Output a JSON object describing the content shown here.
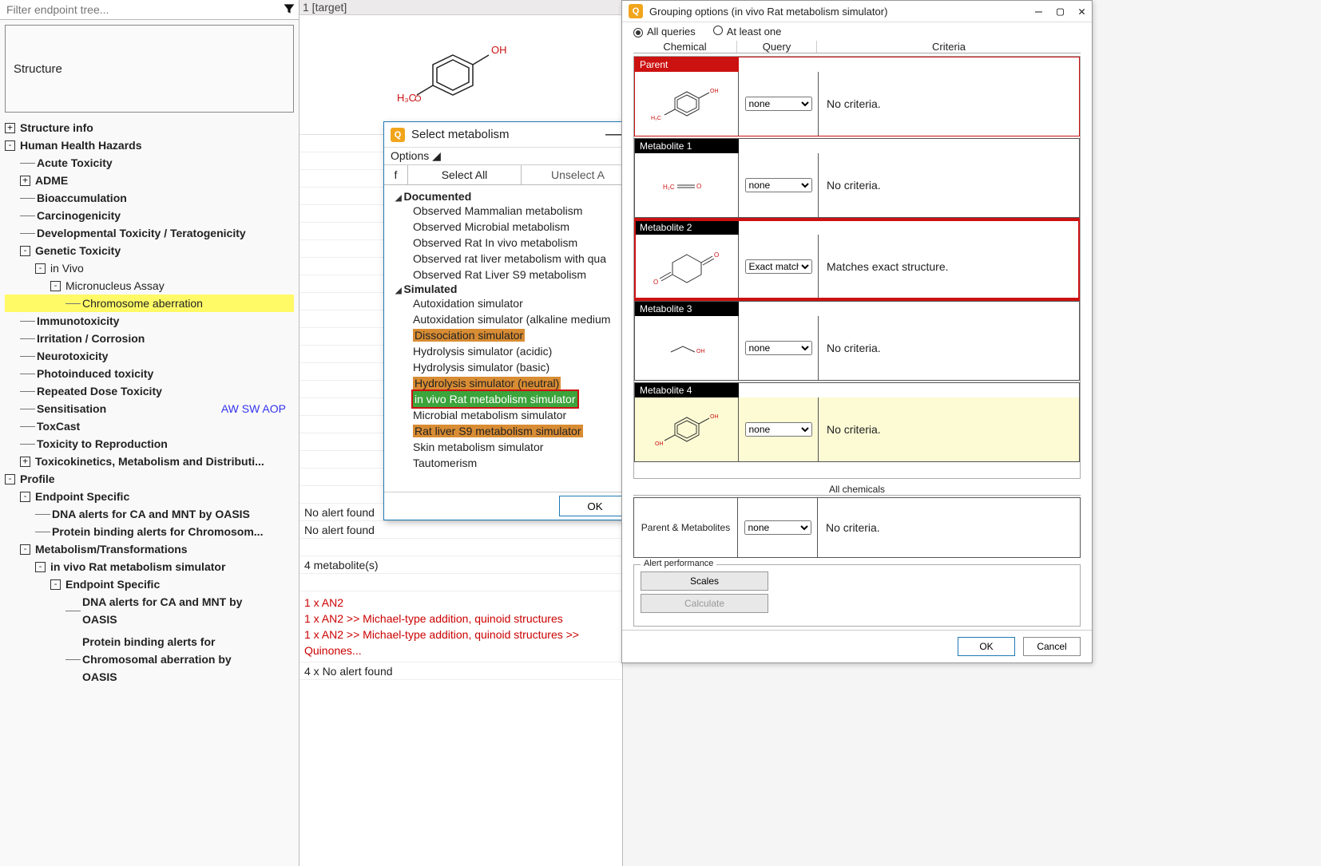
{
  "filter": {
    "placeholder": "Filter endpoint tree..."
  },
  "structure_label": "Structure",
  "tree": {
    "structure_info": "Structure info",
    "hhh": "Human Health Hazards",
    "acute": "Acute Toxicity",
    "adme": "ADME",
    "bioacc": "Bioaccumulation",
    "carcino": "Carcinogenicity",
    "devtox": "Developmental Toxicity / Teratogenicity",
    "gentox": "Genetic Toxicity",
    "invivo": "in Vivo",
    "micro": "Micronucleus Assay",
    "chrom": "Chromosome aberration",
    "immuno": "Immunotoxicity",
    "irrit": "Irritation / Corrosion",
    "neuro": "Neurotoxicity",
    "photo": "Photoinduced toxicity",
    "repdose": "Repeated Dose Toxicity",
    "sens": "Sensitisation",
    "sens_extra": "AW SW AOP",
    "toxcast": "ToxCast",
    "repro": "Toxicity to Reproduction",
    "toxkin": "Toxicokinetics, Metabolism and Distributi...",
    "profile": "Profile",
    "ep_spec": "Endpoint Specific",
    "dna_ca": "DNA alerts for CA and MNT by OASIS",
    "prot_bind": "Protein binding alerts for Chromosom...",
    "metab": "Metabolism/Transformations",
    "invivorat": "in vivo Rat metabolism simulator",
    "ep_spec2": "Endpoint Specific",
    "dna_ca2_a": "DNA alerts for CA and MNT by",
    "dna_ca2_b": "OASIS",
    "prot_bind2_a": "Protein binding alerts for",
    "prot_bind2_b": "Chromosomal aberration by",
    "prot_bind2_c": "OASIS"
  },
  "target_header": "1 [target]",
  "mid": {
    "no_alert": "No alert found",
    "four_metab": "4 metabolite(s)",
    "an2_1": "1 x AN2",
    "an2_2": "1 x AN2 >>  Michael-type addition, quinoid structures",
    "an2_3": "1 x AN2 >>  Michael-type addition, quinoid structures >> Quinones...",
    "four_no": "4 x No alert found"
  },
  "metab_popup": {
    "title": "Select metabolism",
    "options": "Options ◢",
    "f": "f",
    "select_all": "Select All",
    "unselect_all": "Unselect A",
    "documented": "Documented",
    "doc_items": [
      "Observed Mammalian metabolism",
      "Observed Microbial metabolism",
      "Observed Rat In vivo metabolism",
      "Observed rat liver metabolism with qua",
      "Observed Rat Liver S9  metabolism"
    ],
    "simulated": "Simulated",
    "sim_items": [
      {
        "text": "Autoxidation simulator",
        "style": ""
      },
      {
        "text": "Autoxidation simulator (alkaline medium",
        "style": ""
      },
      {
        "text": "Dissociation simulator",
        "style": "orange"
      },
      {
        "text": "Hydrolysis simulator (acidic)",
        "style": ""
      },
      {
        "text": "Hydrolysis simulator (basic)",
        "style": ""
      },
      {
        "text": "Hydrolysis simulator (neutral)",
        "style": "orange"
      },
      {
        "text": "in vivo Rat metabolism simulator",
        "style": "green"
      },
      {
        "text": "Microbial metabolism simulator",
        "style": ""
      },
      {
        "text": "Rat liver S9 metabolism simulator",
        "style": "orange"
      },
      {
        "text": "Skin metabolism simulator",
        "style": ""
      },
      {
        "text": "Tautomerism",
        "style": ""
      }
    ],
    "ok": "OK"
  },
  "group": {
    "title": "Grouping options (in vivo Rat metabolism simulator)",
    "all_queries": "All queries",
    "at_least": "At least one",
    "col_chem": "Chemical",
    "col_query": "Query",
    "col_crit": "Criteria",
    "rows": [
      {
        "header": "Parent",
        "query": "none",
        "criteria": "No criteria.",
        "type": "parent",
        "chem": "parent"
      },
      {
        "header": "Metabolite 1",
        "query": "none",
        "criteria": "No criteria.",
        "type": "black",
        "chem": "m1"
      },
      {
        "header": "Metabolite 2",
        "query": "Exact match",
        "criteria": "Matches exact structure.",
        "type": "red",
        "chem": "m2"
      },
      {
        "header": "Metabolite 3",
        "query": "none",
        "criteria": "No criteria.",
        "type": "black",
        "chem": "m3"
      },
      {
        "header": "Metabolite 4",
        "query": "none",
        "criteria": "No criteria.",
        "type": "yellow",
        "chem": "m4"
      }
    ],
    "all_chem_label": "All chemicals",
    "all_chem_header": "Parent & Metabolites",
    "all_chem_query": "none",
    "all_chem_crit": "No criteria.",
    "alert_perf": "Alert performance",
    "scales": "Scales",
    "calculate": "Calculate",
    "ok": "OK",
    "cancel": "Cancel",
    "query_opts": [
      "none",
      "Exact match"
    ]
  }
}
